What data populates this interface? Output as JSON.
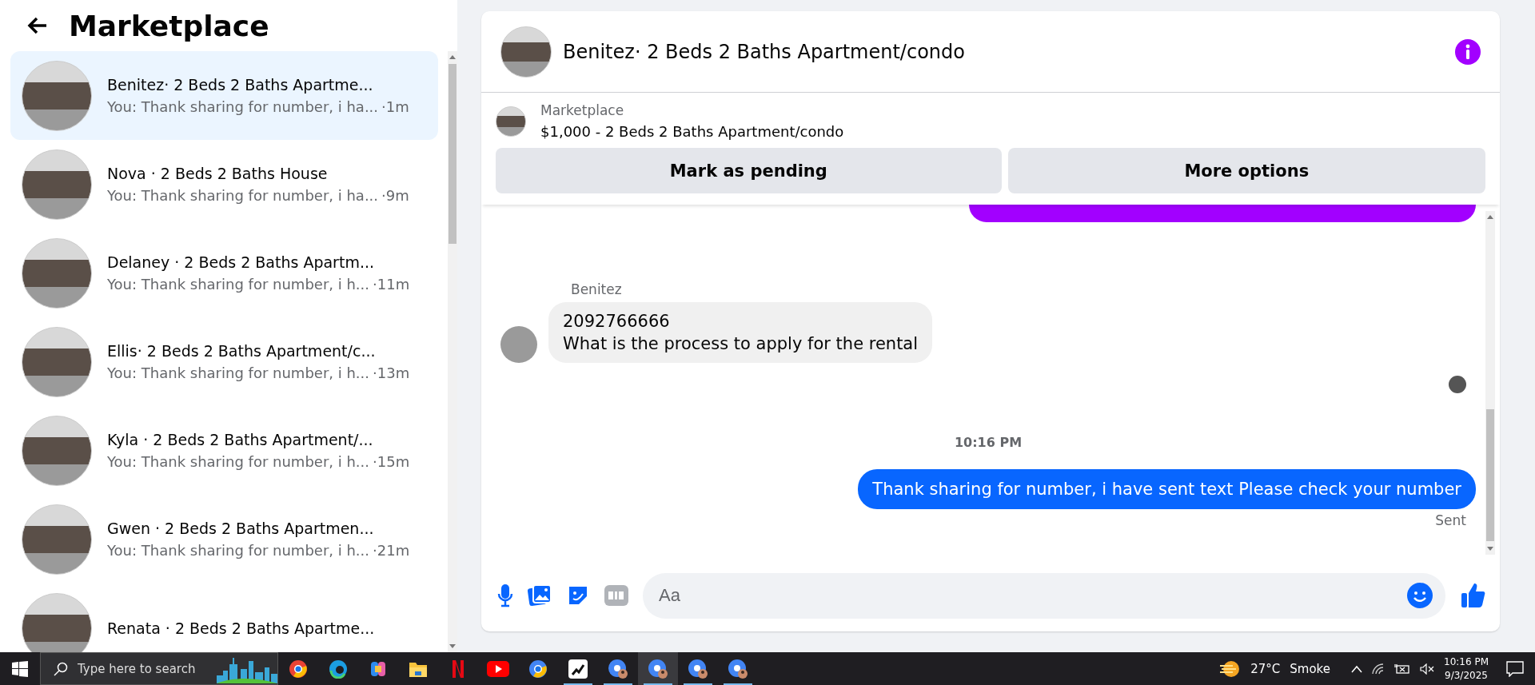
{
  "sidebar": {
    "title": "Marketplace",
    "conversations": [
      {
        "title": "Benitez· 2 Beds 2 Baths Apartme...",
        "snippet": "You: Thank sharing for number, i ha...",
        "time": "·1m",
        "selected": true
      },
      {
        "title": "Nova · 2 Beds 2 Baths House",
        "snippet": "You: Thank sharing for number, i ha...",
        "time": "·9m",
        "selected": false
      },
      {
        "title": "Delaney · 2 Beds 2 Baths Apartm...",
        "snippet": "You: Thank sharing for number, i h...",
        "time": "·11m",
        "selected": false
      },
      {
        "title": "Ellis· 2 Beds 2 Baths Apartment/c...",
        "snippet": "You: Thank sharing for number, i h...",
        "time": "·13m",
        "selected": false
      },
      {
        "title": "Kyla · 2 Beds 2 Baths Apartment/...",
        "snippet": "You: Thank sharing for number, i h...",
        "time": "·15m",
        "selected": false
      },
      {
        "title": "Gwen · 2 Beds 2 Baths Apartmen...",
        "snippet": "You: Thank sharing for number, i h...",
        "time": "·21m",
        "selected": false
      },
      {
        "title": "Renata · 2 Beds 2 Baths Apartme...",
        "selected": false
      }
    ]
  },
  "chat": {
    "title": "Benitez· 2 Beds 2 Baths Apartment/condo",
    "listing": {
      "source": "Marketplace",
      "summary": "$1,000 - 2 Beds 2 Baths Apartment/condo"
    },
    "actions": [
      "Mark as pending",
      "More options"
    ],
    "messages": [
      {
        "kind": "outgoing-cut",
        "color": "#a200ff"
      },
      {
        "kind": "incoming",
        "sender": "Benitez",
        "lines": [
          "2092766666",
          "What is the process to apply for the rental"
        ]
      },
      {
        "kind": "seen"
      },
      {
        "kind": "timestamp",
        "text": "10:16 PM"
      },
      {
        "kind": "outgoing",
        "text": "Thank sharing for number, i have sent text Please check your number",
        "color": "#0866ff"
      },
      {
        "kind": "status",
        "text": "Sent"
      }
    ],
    "composer": {
      "placeholder": "Aa"
    }
  },
  "taskbar": {
    "search_placeholder": "Type here to search",
    "apps": [
      {
        "kind": "chrome",
        "open": false,
        "active": false
      },
      {
        "kind": "edge",
        "open": false,
        "active": false
      },
      {
        "kind": "copilot",
        "open": false,
        "active": false
      },
      {
        "kind": "folder",
        "open": false,
        "active": false
      },
      {
        "kind": "netflix",
        "open": false,
        "active": false
      },
      {
        "kind": "youtube",
        "open": false,
        "active": false
      },
      {
        "kind": "chrome-alt",
        "open": false,
        "active": false
      },
      {
        "kind": "chart",
        "open": true,
        "active": false
      },
      {
        "kind": "profile",
        "open": true,
        "active": false
      },
      {
        "kind": "profile",
        "open": true,
        "active": true
      },
      {
        "kind": "profile",
        "open": true,
        "active": false
      },
      {
        "kind": "profile",
        "open": true,
        "active": false
      }
    ],
    "weather": {
      "temp": "27°C",
      "condition": "Smoke"
    },
    "clock": {
      "time": "10:16 PM",
      "date": "9/3/2025"
    }
  }
}
